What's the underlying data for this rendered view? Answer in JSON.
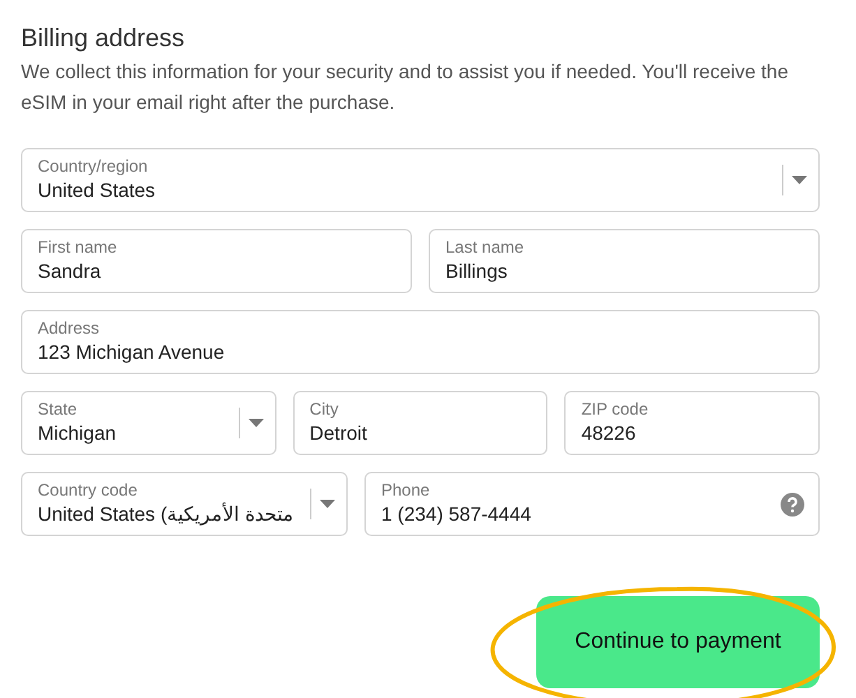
{
  "title": "Billing address",
  "description": "We collect this information for your security and to assist you if needed. You'll receive the eSIM in your email right after the purchase.",
  "rows": [
    {
      "fields": [
        {
          "kind": "select",
          "label": "Country/region",
          "value": "United States"
        }
      ]
    },
    {
      "fields": [
        {
          "kind": "text",
          "label": "First name",
          "value": "Sandra"
        },
        {
          "kind": "text",
          "label": "Last name",
          "value": "Billings"
        }
      ]
    },
    {
      "fields": [
        {
          "kind": "text",
          "label": "Address",
          "value": "123 Michigan Avenue"
        }
      ]
    },
    {
      "fields": [
        {
          "kind": "select",
          "label": "State",
          "value": "Michigan"
        },
        {
          "kind": "text",
          "label": "City",
          "value": "Detroit"
        },
        {
          "kind": "text",
          "label": "ZIP code",
          "value": "48226"
        }
      ]
    },
    {
      "fields": [
        {
          "kind": "select",
          "label": "Country code",
          "value": "United States (متحدة الأمريكية"
        },
        {
          "kind": "help",
          "label": "Phone",
          "value": "1 (234) 587-4444"
        }
      ]
    }
  ],
  "submit": {
    "label": "Continue to payment",
    "circled": true
  }
}
